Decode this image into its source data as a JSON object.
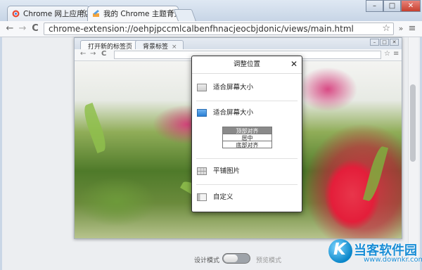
{
  "browser": {
    "tabs": [
      {
        "title": "Chrome 网上应用店 - 我",
        "active": false
      },
      {
        "title": "我的 Chrome 主题背景",
        "active": true
      }
    ],
    "window_buttons": [
      "–",
      "□",
      "✕"
    ],
    "url": "chrome-extension://oehpjpccmlcalbenfhnacjeocbjdonic/views/main.html",
    "nav": {
      "back": "←",
      "forward": "→",
      "reload": "C"
    },
    "menu_glyphs": {
      "star": "☆",
      "more": "»",
      "wrench": "≡"
    }
  },
  "preview": {
    "tabs": [
      {
        "title": "打开新的标签页",
        "active": true
      },
      {
        "title": "背景标签",
        "active": false
      }
    ]
  },
  "dialog": {
    "title": "调整位置",
    "close": "✕",
    "options": [
      {
        "label": "适合屏幕大小",
        "icon": "fit-screen-icon"
      },
      {
        "label": "适合屏幕大小",
        "icon": "fit-screen-selected-icon",
        "selected": true
      },
      {
        "label": "平铺图片",
        "icon": "tile-icon"
      },
      {
        "label": "自定义",
        "icon": "custom-icon"
      }
    ],
    "alignment": [
      "顶部对齐",
      "居中",
      "底部对齐"
    ],
    "alignment_selected": "顶部对齐"
  },
  "toggle": {
    "left_label": "设计模式",
    "right_label": "预览模式"
  },
  "watermark": {
    "name": "当客软件园",
    "url": "www.downkr.com",
    "logo_letter": "K"
  }
}
